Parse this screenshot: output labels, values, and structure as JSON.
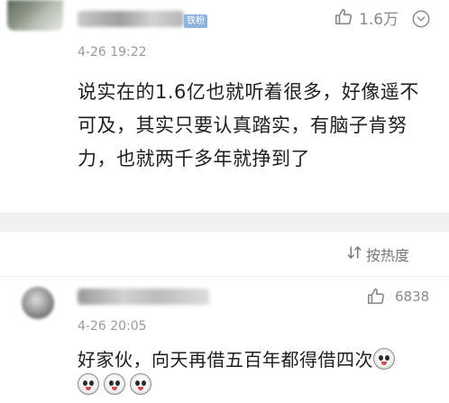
{
  "comment1": {
    "badge": "铁粉",
    "time": "4-26 19:22",
    "like_count": "1.6万",
    "text": "说实在的1.6亿也就听着很多，好像遥不可及，其实只要认真踏实，有脑子肯努力，也就两千多年就挣到了"
  },
  "sort": {
    "label": "按热度"
  },
  "comment2": {
    "time": "4-26 20:05",
    "like_count": "6838",
    "text": "好家伙，向天再借五百年都得借四次"
  },
  "icons": {
    "like": "thumb-up-icon",
    "more": "circle-more-icon",
    "sort": "sort-icon",
    "emoji": "crying-emoji-icon"
  }
}
